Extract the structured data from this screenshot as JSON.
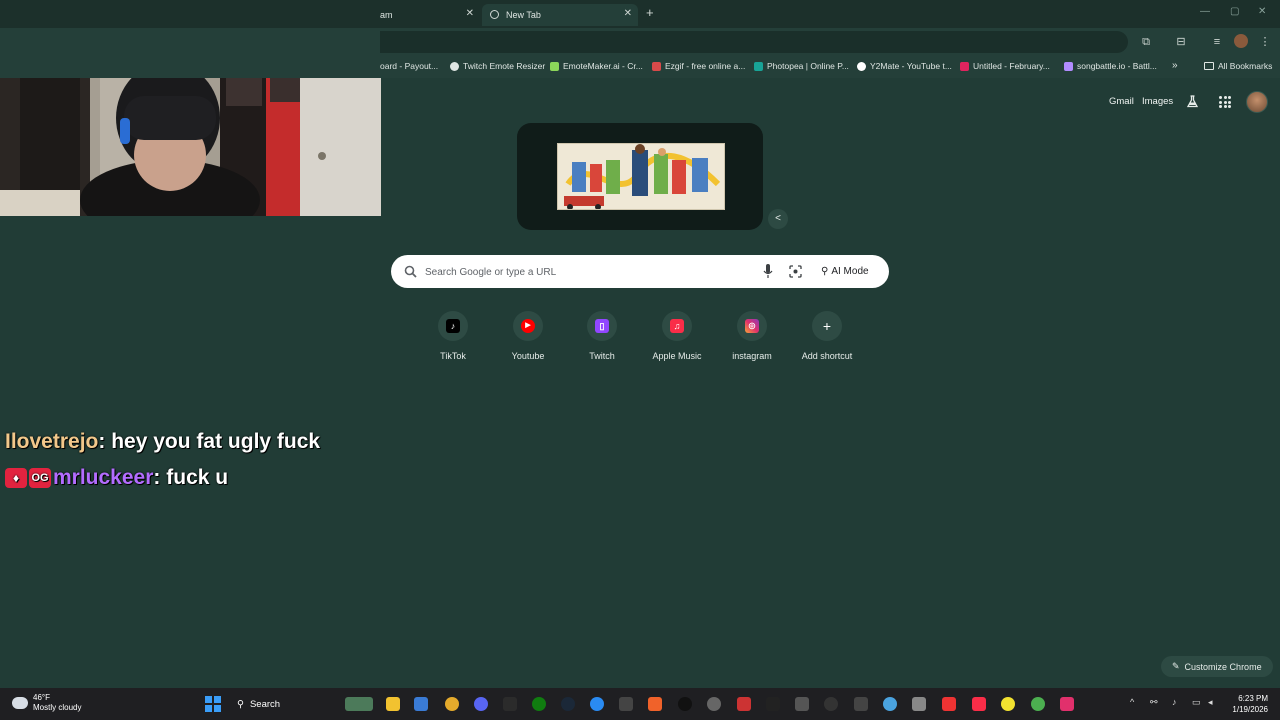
{
  "browser": {
    "tabs": [
      {
        "label": "am"
      },
      {
        "label": "New Tab"
      }
    ],
    "bookmarks": [
      {
        "label": "oard - Payout...",
        "color": "#7ea1ff"
      },
      {
        "label": "Twitch Emote Resizer",
        "color": "#dfe6e3"
      },
      {
        "label": "EmoteMaker.ai - Cr...",
        "color": "#8cd65a"
      },
      {
        "label": "Ezgif - free online a...",
        "color": "#d94a4a"
      },
      {
        "label": "Photopea | Online P...",
        "color": "#18a497"
      },
      {
        "label": "Y2Mate - YouTube t...",
        "color": "#ffffff"
      },
      {
        "label": "Untitled - February...",
        "color": "#e0245e"
      },
      {
        "label": "songbattle.io - Battl...",
        "color": "#b18cff"
      }
    ],
    "all_bookmarks": "All Bookmarks"
  },
  "header": {
    "gmail": "Gmail",
    "images": "Images"
  },
  "search": {
    "placeholder": "Search Google or type a URL",
    "ai_mode": "AI Mode"
  },
  "shortcuts": [
    {
      "label": "TikTok",
      "icon": "tiktok-icon",
      "color": "#000000"
    },
    {
      "label": "Youtube",
      "icon": "youtube-icon",
      "color": "#ff0000"
    },
    {
      "label": "Twitch",
      "icon": "twitch-icon",
      "color": "#9146ff"
    },
    {
      "label": "Apple Music",
      "icon": "apple-music-icon",
      "color": "#fa2d48"
    },
    {
      "label": "instagram",
      "icon": "instagram-icon",
      "color": "#e1306c"
    },
    {
      "label": "Add shortcut",
      "icon": "plus-icon",
      "color": "#2e4b44"
    }
  ],
  "chat": [
    {
      "user": "Ilovetrejo",
      "sep": ":",
      "message": "hey you fat ugly fuck"
    },
    {
      "user": "mrluckeer",
      "sep": ":",
      "message": "fuck u"
    }
  ],
  "customize_label": "Customize Chrome",
  "taskbar": {
    "temp": "46°F",
    "weather": "Mostly cloudy",
    "search": "Search",
    "time": "6:23 PM",
    "date": "1/19/2026"
  },
  "colors": {
    "page_bg": "#213c36",
    "twitch_user_1": "#f2c88b",
    "twitch_user_2": "#b36cff"
  }
}
